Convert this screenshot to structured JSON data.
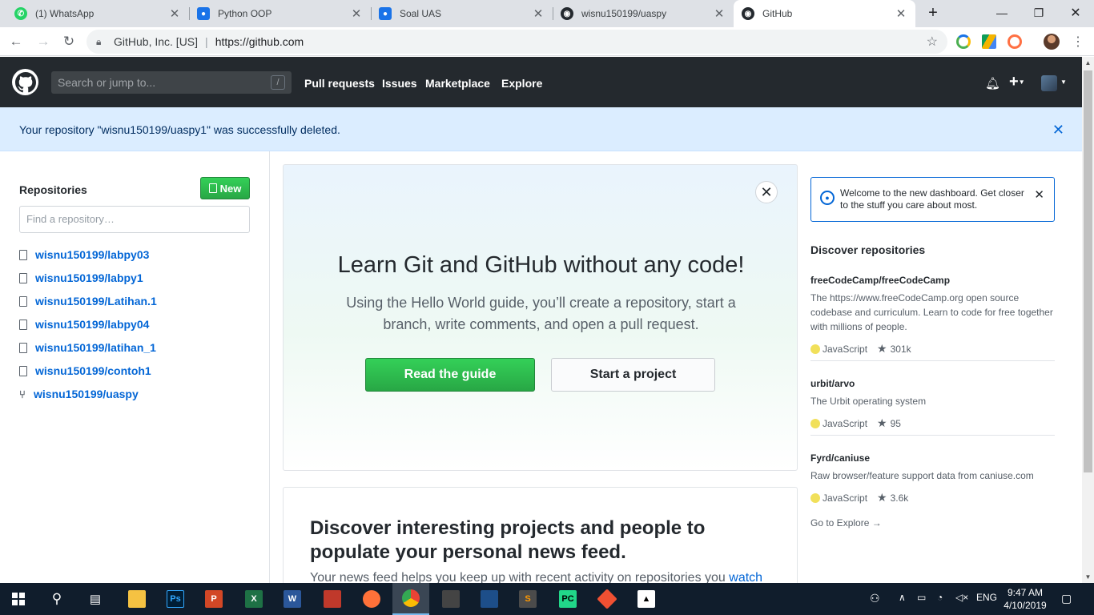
{
  "browser": {
    "tabs": [
      {
        "label": "(1) WhatsApp",
        "icon": "whatsapp-icon",
        "color": "#25d366"
      },
      {
        "label": "Python OOP",
        "icon": "google-classroom-icon",
        "color": "#1a73e8"
      },
      {
        "label": "Soal UAS",
        "icon": "google-classroom-icon",
        "color": "#1a73e8"
      },
      {
        "label": "wisnu150199/uaspy",
        "icon": "github-icon",
        "color": "#24292e"
      },
      {
        "label": "GitHub",
        "icon": "github-icon",
        "color": "#24292e",
        "active": true
      }
    ],
    "site_identity": "GitHub, Inc. [US]",
    "url": "https://github.com"
  },
  "github": {
    "search_placeholder": "Search or jump to...",
    "search_shortcut": "/",
    "nav": [
      "Pull requests",
      "Issues",
      "Marketplace",
      "Explore"
    ],
    "flash_message": "Your repository \"wisnu150199/uaspy1\" was successfully deleted.",
    "sidebar": {
      "heading": "Repositories",
      "new_button": "New",
      "filter_placeholder": "Find a repository…",
      "repos": [
        {
          "name": "wisnu150199/labpy03",
          "type": "repo"
        },
        {
          "name": "wisnu150199/labpy1",
          "type": "repo"
        },
        {
          "name": "wisnu150199/Latihan.1",
          "type": "repo"
        },
        {
          "name": "wisnu150199/labpy04",
          "type": "repo"
        },
        {
          "name": "wisnu150199/latihan_1",
          "type": "repo"
        },
        {
          "name": "wisnu150199/contoh1",
          "type": "repo"
        },
        {
          "name": "wisnu150199/uaspy",
          "type": "fork"
        }
      ]
    },
    "hero": {
      "title": "Learn Git and GitHub without any code!",
      "text": "Using the Hello World guide, you’ll create a repository, start a branch, write comments, and open a pull request.",
      "primary_button": "Read the guide",
      "secondary_button": "Start a project"
    },
    "discover": {
      "title": "Discover interesting projects and people to populate your personal news feed.",
      "text": "Your news feed helps you keep up with recent activity on repositories you",
      "link": "watch"
    },
    "welcome": "Welcome to the new dashboard. Get closer to the stuff you care about most.",
    "discover_repos": {
      "heading": "Discover repositories",
      "items": [
        {
          "name": "freeCodeCamp/freeCodeCamp",
          "description": "The https://www.freeCodeCamp.org open source codebase and curriculum. Learn to code for free together with millions of people.",
          "language": "JavaScript",
          "stars": "301k"
        },
        {
          "name": "urbit/arvo",
          "description": "The Urbit operating system",
          "language": "JavaScript",
          "stars": "95"
        },
        {
          "name": "Fyrd/caniuse",
          "description": "Raw browser/feature support data from caniuse.com",
          "language": "JavaScript",
          "stars": "3.6k"
        }
      ],
      "explore_link": "Go to Explore →"
    }
  },
  "taskbar": {
    "language": "ENG",
    "time": "9:47 AM",
    "date": "4/10/2019"
  }
}
